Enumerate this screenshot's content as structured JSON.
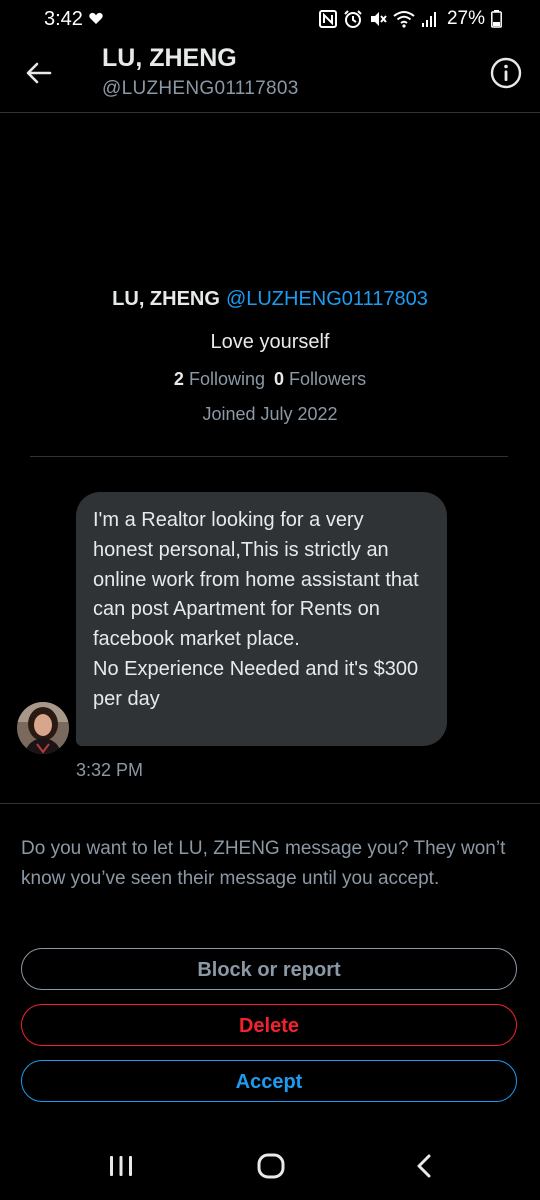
{
  "status_bar": {
    "time": "3:42",
    "battery": "27%",
    "icons": [
      "heart-icon",
      "nfc-icon",
      "alarm-icon",
      "mute-icon",
      "wifi-icon",
      "signal-icon",
      "battery-icon"
    ]
  },
  "header": {
    "name": "LU, ZHENG",
    "handle": "@LUZHENG01117803"
  },
  "profile": {
    "name": "LU, ZHENG",
    "handle": "@LUZHENG01117803",
    "bio": "Love yourself",
    "following_count": "2",
    "following_label": "Following",
    "followers_count": "0",
    "followers_label": "Followers",
    "joined": "Joined July 2022"
  },
  "message": {
    "text": "I'm a Realtor looking for a very honest personal,This is strictly an online work from home assistant that can post Apartment for Rents on facebook market place.\nNo Experience Needed and it's $300 per day",
    "time": "3:32 PM"
  },
  "request": {
    "prompt": "Do you want to let LU, ZHENG message you? They won’t know you’ve seen their message until you accept.",
    "block_label": "Block or report",
    "delete_label": "Delete",
    "accept_label": "Accept"
  },
  "colors": {
    "background": "#000000",
    "accent": "#1d9bf0",
    "danger": "#f4212e",
    "muted": "#8b98a5",
    "bubble": "#2f3336"
  }
}
